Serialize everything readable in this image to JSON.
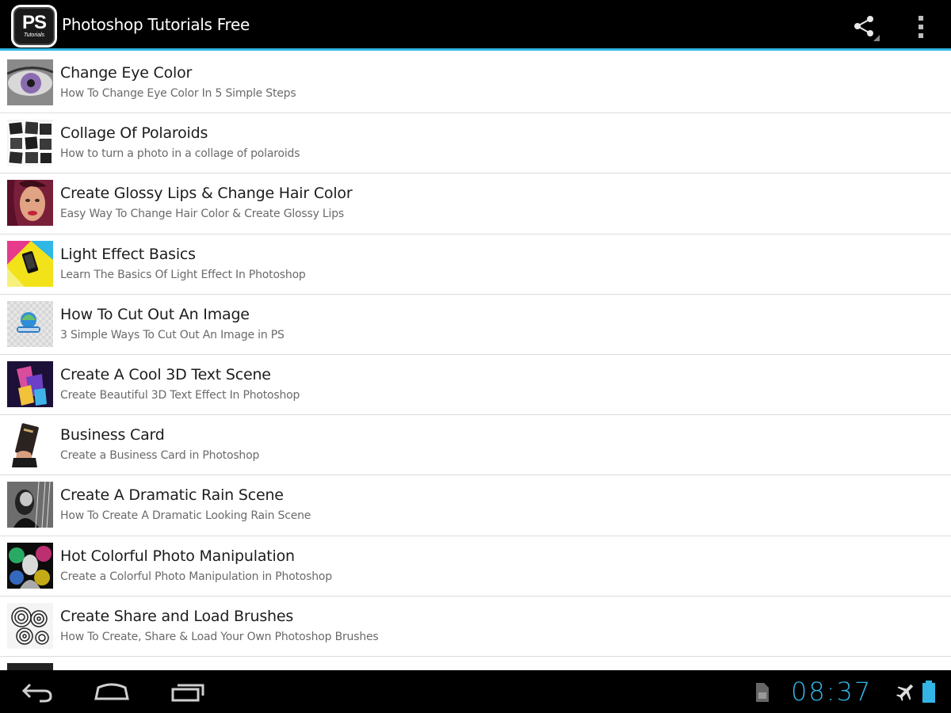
{
  "app": {
    "icon_text": "PS",
    "icon_subtext": "Tutorials",
    "title": "Photoshop Tutorials Free",
    "accent_color": "#33b5e5"
  },
  "action_bar": {
    "share_icon": "share-icon",
    "overflow_icon": "overflow-menu-icon"
  },
  "tutorials": [
    {
      "title": "Change Eye Color",
      "subtitle": "How To Change Eye Color In 5 Simple Steps",
      "thumb": "eye-thumbnail"
    },
    {
      "title": "Collage Of Polaroids",
      "subtitle": "How to turn a photo in a collage of polaroids",
      "thumb": "polaroids-thumbnail"
    },
    {
      "title": "Create Glossy Lips & Change Hair Color",
      "subtitle": "Easy Way To Change Hair Color & Create Glossy Lips",
      "thumb": "portrait-thumbnail"
    },
    {
      "title": "Light Effect Basics",
      "subtitle": "Learn The Basics Of Light Effect In Photoshop",
      "thumb": "light-effect-thumbnail"
    },
    {
      "title": "How To Cut Out An Image",
      "subtitle": "3 Simple Ways To Cut Out An Image in PS",
      "thumb": "cutout-thumbnail"
    },
    {
      "title": "Create A Cool 3D Text Scene",
      "subtitle": "Create Beautiful 3D Text Effect In Photoshop",
      "thumb": "3d-text-thumbnail"
    },
    {
      "title": "Business Card",
      "subtitle": "Create a Business Card in Photoshop",
      "thumb": "business-card-thumbnail"
    },
    {
      "title": "Create A Dramatic Rain Scene",
      "subtitle": "How To Create A Dramatic Looking Rain Scene",
      "thumb": "rain-scene-thumbnail"
    },
    {
      "title": "Hot Colorful Photo Manipulation",
      "subtitle": "Create a Colorful Photo Manipulation in Photoshop",
      "thumb": "colorful-manipulation-thumbnail"
    },
    {
      "title": "Create Share and Load Brushes",
      "subtitle": "How To Create, Share & Load Your Own Photoshop Brushes",
      "thumb": "brushes-thumbnail"
    }
  ],
  "system_bar": {
    "time": "08:37",
    "back_icon": "back-icon",
    "home_icon": "home-icon",
    "recents_icon": "recent-apps-icon",
    "storage_icon": "sd-card-icon",
    "airplane_icon": "airplane-mode-icon",
    "battery_icon": "battery-icon"
  }
}
